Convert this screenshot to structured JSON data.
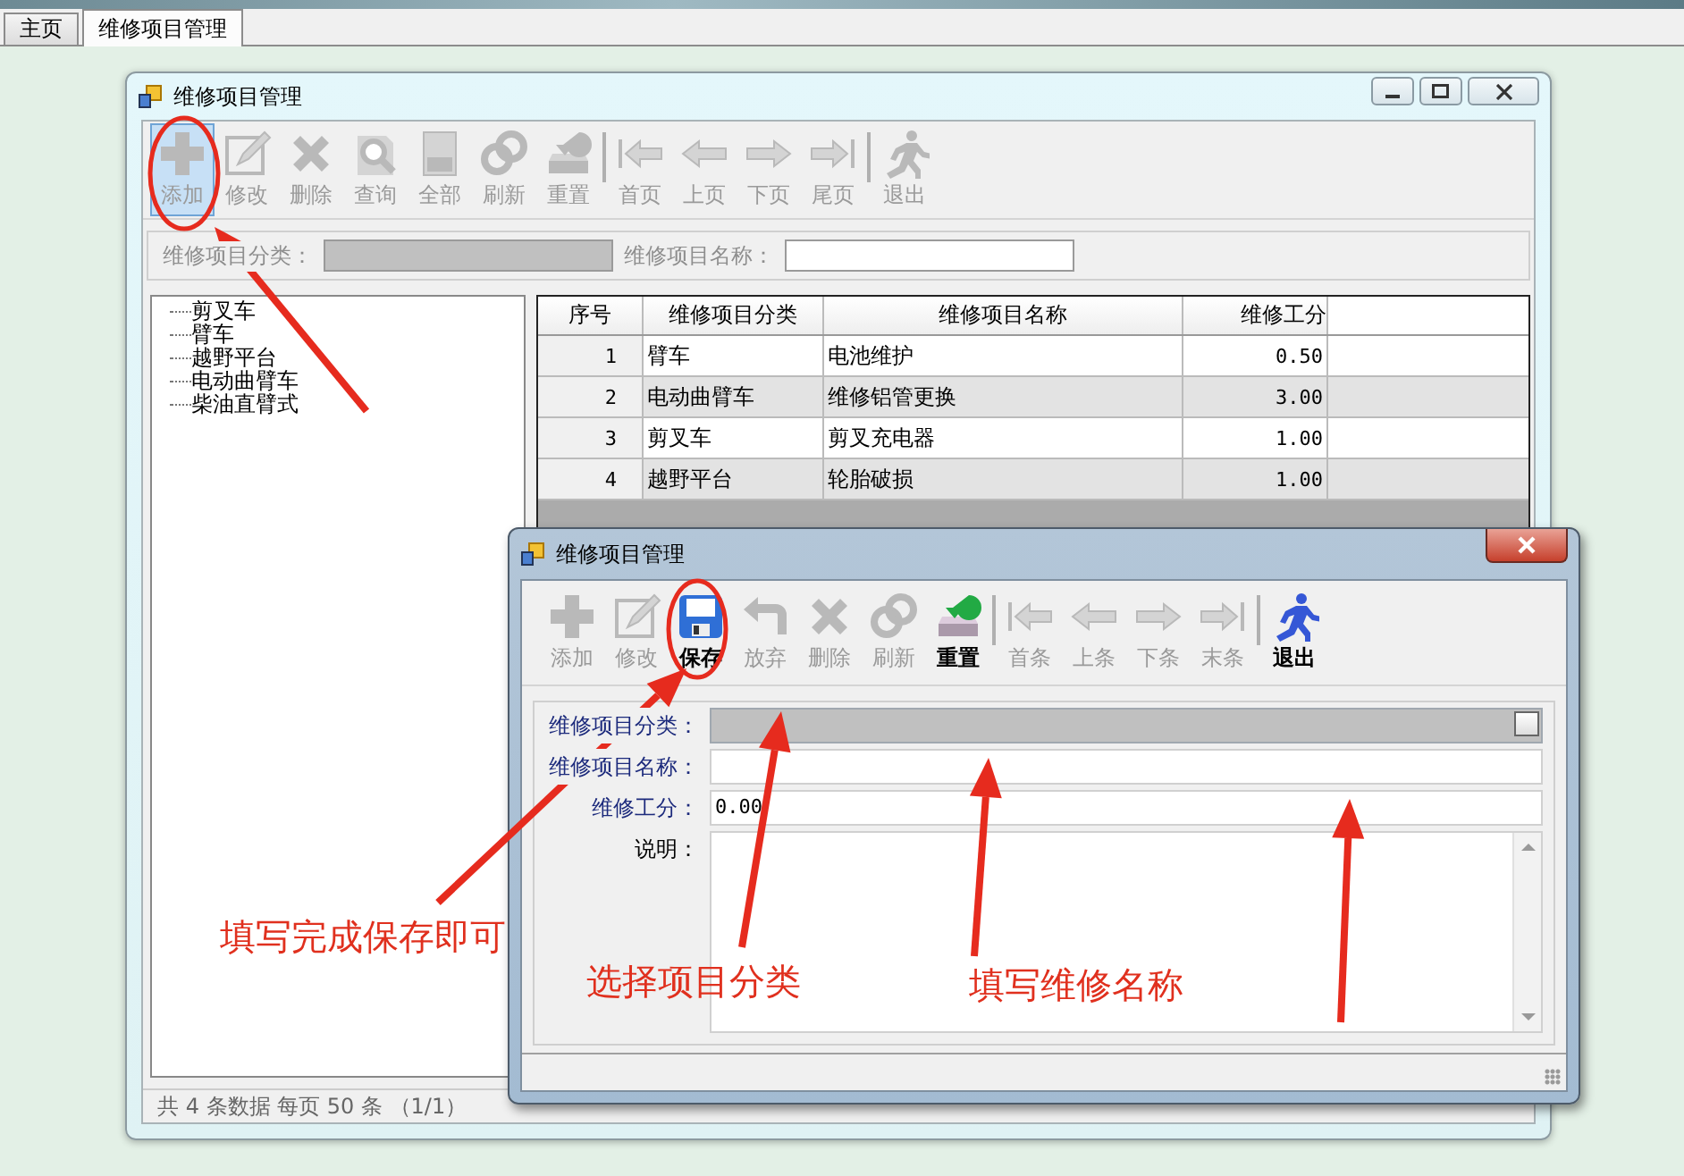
{
  "app_tabs": [
    {
      "label": "主页",
      "selected": false
    },
    {
      "label": "维修项目管理",
      "selected": true
    }
  ],
  "main_window": {
    "title": "维修项目管理",
    "toolbar": [
      {
        "kind": "add",
        "label": "添加",
        "disabled": true,
        "highlighted": true
      },
      {
        "kind": "edit",
        "label": "修改",
        "disabled": true,
        "highlighted": false
      },
      {
        "kind": "delete",
        "label": "删除",
        "disabled": true,
        "highlighted": false
      },
      {
        "kind": "search",
        "label": "查询",
        "disabled": true,
        "highlighted": false
      },
      {
        "kind": "all",
        "label": "全部",
        "disabled": true,
        "highlighted": false
      },
      {
        "kind": "refresh",
        "label": "刷新",
        "disabled": true,
        "highlighted": false
      },
      {
        "kind": "reset",
        "label": "重置",
        "disabled": true,
        "highlighted": false
      },
      {
        "kind": "first",
        "label": "首页",
        "disabled": true,
        "highlighted": false
      },
      {
        "kind": "prev",
        "label": "上页",
        "disabled": true,
        "highlighted": false
      },
      {
        "kind": "next",
        "label": "下页",
        "disabled": true,
        "highlighted": false
      },
      {
        "kind": "last",
        "label": "尾页",
        "disabled": true,
        "highlighted": false
      },
      {
        "kind": "exit",
        "label": "退出",
        "disabled": true,
        "highlighted": false
      }
    ],
    "filters": [
      {
        "kind": "combo",
        "label": "维修项目分类："
      },
      {
        "kind": "text",
        "label": "维修项目名称："
      }
    ],
    "tree": {
      "items": [
        {
          "label": "剪叉车"
        },
        {
          "label": "臂车"
        },
        {
          "label": "越野平台"
        },
        {
          "label": "电动曲臂车"
        },
        {
          "label": "柴油直臂式"
        }
      ]
    },
    "table": {
      "columns": [
        "序号",
        "维修项目分类",
        "维修项目名称",
        "维修工分"
      ],
      "rows": [
        [
          "1",
          "臂车",
          "电池维护",
          "0.50"
        ],
        [
          "2",
          "电动曲臂车",
          "维修铝管更换",
          "3.00"
        ],
        [
          "3",
          "剪叉车",
          "剪叉充电器",
          "1.00"
        ],
        [
          "4",
          "越野平台",
          "轮胎破损",
          "1.00"
        ]
      ]
    },
    "status_bar": "共 4 条数据  每页 50 条 （1/1）"
  },
  "dialog": {
    "title": "维修项目管理",
    "toolbar": [
      {
        "kind": "add",
        "label": "添加",
        "disabled": true
      },
      {
        "kind": "edit",
        "label": "修改",
        "disabled": true
      },
      {
        "kind": "save",
        "label": "保存",
        "disabled": false
      },
      {
        "kind": "undo",
        "label": "放弃",
        "disabled": true
      },
      {
        "kind": "delete",
        "label": "删除",
        "disabled": true
      },
      {
        "kind": "refresh",
        "label": "刷新",
        "disabled": true
      },
      {
        "kind": "reset",
        "label": "重置",
        "disabled": false
      },
      {
        "kind": "first",
        "label": "首条",
        "disabled": true
      },
      {
        "kind": "prev",
        "label": "上条",
        "disabled": true
      },
      {
        "kind": "next",
        "label": "下条",
        "disabled": true
      },
      {
        "kind": "last",
        "label": "末条",
        "disabled": true
      },
      {
        "kind": "exit",
        "label": "退出",
        "disabled": false
      }
    ],
    "fields": [
      {
        "kind": "combo",
        "label": "维修项目分类：",
        "required": true
      },
      {
        "kind": "text",
        "label": "维修项目名称：",
        "required": true
      },
      {
        "kind": "text",
        "label": "维修工分：",
        "required": true,
        "value": "0.00"
      },
      {
        "kind": "textarea",
        "label": "说明：",
        "required": false
      }
    ]
  },
  "annotations": [
    {
      "text": "填写完成保存即可"
    },
    {
      "text": "选择项目分类"
    },
    {
      "text": "填写维修名称"
    }
  ]
}
